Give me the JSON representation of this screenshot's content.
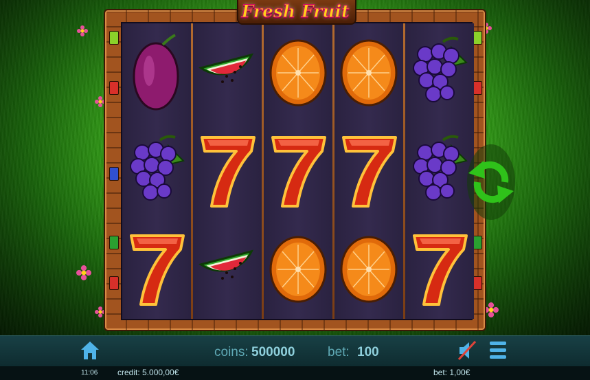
{
  "game": {
    "logo": "Fresh Fruit"
  },
  "reels": [
    [
      "plum",
      "grapes",
      "seven"
    ],
    [
      "watermelon",
      "seven",
      "watermelon"
    ],
    [
      "orange",
      "seven",
      "orange"
    ],
    [
      "orange",
      "seven",
      "orange"
    ],
    [
      "grapes",
      "grapes",
      "seven"
    ]
  ],
  "bottom_bar": {
    "coins_label": "coins:",
    "coins_value": "500000",
    "bet_label": "bet:",
    "bet_value": "100",
    "icons": [
      "home-icon",
      "sound-muted-icon",
      "menu-icon"
    ]
  },
  "status_bar": {
    "time": "11:06",
    "credit": "credit: 5.000,00€",
    "bet": "bet: 1,00€"
  },
  "controls": {
    "spin_icon": "refresh-icon"
  },
  "colors": {
    "accent": "#8fd0dc",
    "label": "#5fa9b5",
    "spin": "#2fc21a"
  }
}
